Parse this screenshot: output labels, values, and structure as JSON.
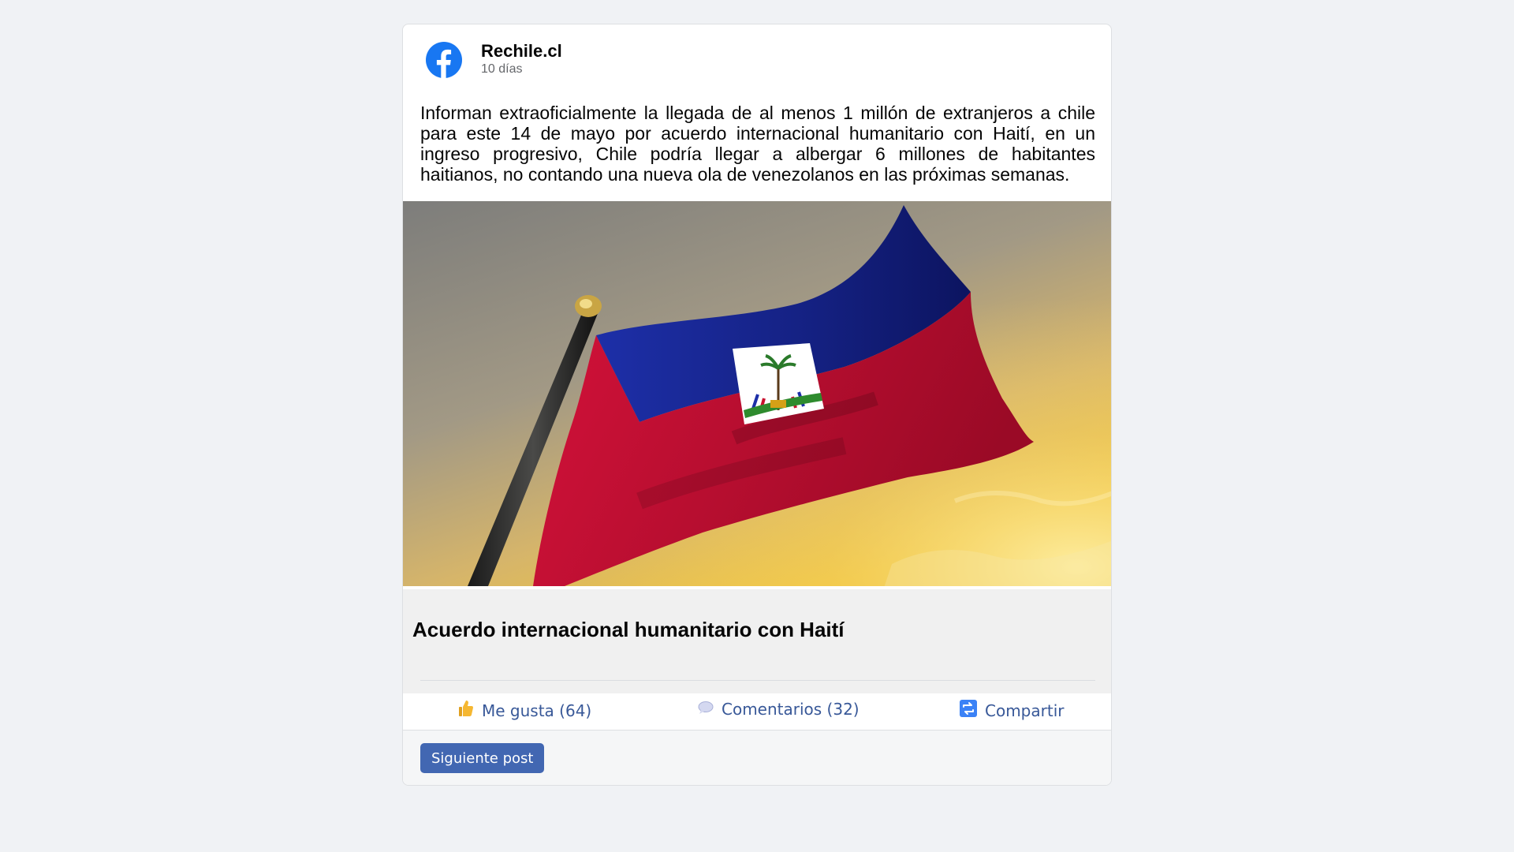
{
  "post": {
    "author": "Rechile.cl",
    "time": "10 días",
    "body": "Informan extraoficialmente la llegada de al menos 1 millón de extranjeros a chile para este 14 de mayo por acuerdo internacional humanitario con Haití, en un ingreso progresivo, Chile podría llegar a albergar 6 millones de habitantes haitianos, no contando una nueva ola de venezolanos en las próximas semanas.",
    "link_title": "Acuerdo internacional humanitario con Haití"
  },
  "actions": {
    "like": {
      "icon": "thumbs-up-icon",
      "label": "Me gusta (64)"
    },
    "comment": {
      "icon": "speech-bubble-icon",
      "label": "Comentarios (32)"
    },
    "share": {
      "icon": "share-icon",
      "label": "Compartir"
    }
  },
  "footer": {
    "next_label": "Siguiente post"
  },
  "colors": {
    "facebook_blue": "#1877f2",
    "link_blue": "#385898",
    "button_blue": "#4267b2",
    "flag_blue": "#1a2a8c",
    "flag_red": "#c8102e"
  }
}
